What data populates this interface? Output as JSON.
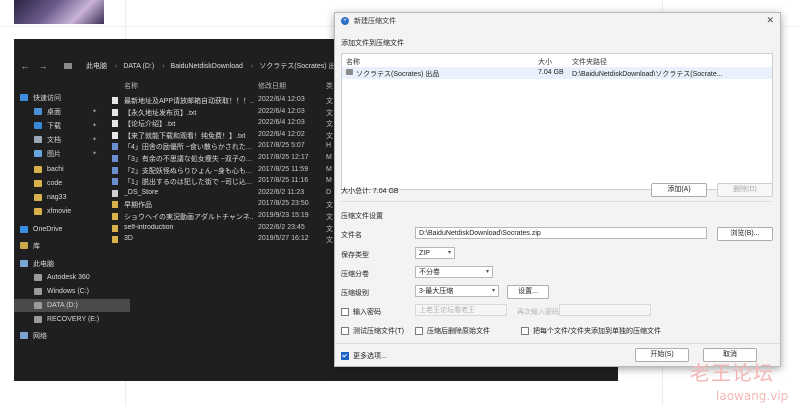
{
  "explorer": {
    "breadcrumb": [
      "此电脑",
      "DATA (D:)",
      "BaiduNetdiskDownload",
      "ソクラテス(Socrates) 出品"
    ],
    "columns": {
      "name": "名称",
      "date": "修改日期",
      "type": "类"
    },
    "sidebar": [
      {
        "label": "快速访问",
        "icon": "star-icon",
        "pinned": false,
        "level": 0
      },
      {
        "label": "桌面",
        "icon": "desktop-icon",
        "pinned": true,
        "level": 1
      },
      {
        "label": "下载",
        "icon": "download-icon",
        "pinned": true,
        "level": 1
      },
      {
        "label": "文档",
        "icon": "document-icon",
        "pinned": true,
        "level": 1
      },
      {
        "label": "图片",
        "icon": "picture-icon",
        "pinned": true,
        "level": 1
      },
      {
        "label": "bachi",
        "icon": "folder-icon",
        "pinned": false,
        "level": 1
      },
      {
        "label": "code",
        "icon": "folder-icon",
        "pinned": false,
        "level": 1
      },
      {
        "label": "nag33",
        "icon": "folder-icon",
        "pinned": false,
        "level": 1
      },
      {
        "label": "xfmovie",
        "icon": "folder-icon",
        "pinned": false,
        "level": 1
      },
      {
        "label": "OneDrive",
        "icon": "cloud-icon",
        "pinned": false,
        "level": 0
      },
      {
        "label": "库",
        "icon": "library-icon",
        "pinned": false,
        "level": 0
      },
      {
        "label": "此电脑",
        "icon": "computer-icon",
        "pinned": false,
        "level": 0
      },
      {
        "label": "Autodesk 360",
        "icon": "cloud-drive-icon",
        "pinned": false,
        "level": 1
      },
      {
        "label": "Windows (C:)",
        "icon": "drive-icon",
        "pinned": false,
        "level": 1
      },
      {
        "label": "DATA (D:)",
        "icon": "drive-icon",
        "pinned": false,
        "level": 1,
        "selected": true
      },
      {
        "label": "RECOVERY (E:)",
        "icon": "drive-icon",
        "pinned": false,
        "level": 1
      },
      {
        "label": "网络",
        "icon": "network-icon",
        "pinned": false,
        "level": 0
      }
    ],
    "files": [
      {
        "name": "最新地址及APP请放邮箱自动获取！！！...",
        "date": "2022/6/4 12:03",
        "type": "文",
        "icon": "text-file-icon"
      },
      {
        "name": "【永久地址发布页】.txt",
        "date": "2022/6/4 12:03",
        "type": "文",
        "icon": "text-file-icon"
      },
      {
        "name": "【论坛介绍】.txt",
        "date": "2022/6/4 12:03",
        "type": "文",
        "icon": "text-file-icon"
      },
      {
        "name": "【来了就能下载和观看！纯免费！】.txt",
        "date": "2022/6/4 12:02",
        "type": "文",
        "icon": "text-file-icon"
      },
      {
        "name": "「4」田舎の励優所 ~食い散らかされた...",
        "date": "2017/8/25 5:07",
        "type": "H",
        "icon": "media-file-icon"
      },
      {
        "name": "「3」有余の不思議な処女痩失 ~双子の...",
        "date": "2017/8/25 12:17",
        "type": "M",
        "icon": "media-file-icon"
      },
      {
        "name": "「2」支配妖怪ぬらりひょん ~身も心も...",
        "date": "2017/8/25 11:59",
        "type": "M",
        "icon": "media-file-icon"
      },
      {
        "name": "「1」脱出するのは犯した街で ~司じ込...",
        "date": "2017/8/25 11:16",
        "type": "M",
        "icon": "media-file-icon"
      },
      {
        "name": "_DS_Store",
        "date": "2022/6/2 11:23",
        "type": "D",
        "icon": "file-icon"
      },
      {
        "name": "早期作品",
        "date": "2017/8/25 23:50",
        "type": "文",
        "icon": "folder-icon"
      },
      {
        "name": "ショウヘイの実況動画アダルトチャンネ...",
        "date": "2019/9/23 15:19",
        "type": "文",
        "icon": "folder-icon"
      },
      {
        "name": "self-introduction",
        "date": "2022/6/2 23:45",
        "type": "文",
        "icon": "folder-icon"
      },
      {
        "name": "3D",
        "date": "2019/5/27 16:12",
        "type": "文",
        "icon": "folder-icon"
      }
    ]
  },
  "dialog": {
    "title": "新建压缩文件",
    "add_section": "添加文件到压缩文件",
    "headers": {
      "name": "名称",
      "size": "大小",
      "path": "文件夹路径"
    },
    "rows": [
      {
        "name": "ソクラテス(Socrates) 出品",
        "size": "7.04 GB",
        "path": "D:\\BaiduNetdiskDownload\\ソクラテス(Socrate..."
      }
    ],
    "total_size": "大小总计: 7.04 GB",
    "add_button": "添加(A)",
    "delete_button": "删除(D)",
    "settings_section": "压缩文件设置",
    "filename_label": "文件名",
    "filename_value": "D:\\BaiduNetdiskDownload\\Socrates.zip",
    "browse_button": "浏览(B)...",
    "format_label": "保存类型",
    "format_value": "ZIP",
    "split_label": "压缩分卷",
    "split_value": "不分卷",
    "level_label": "压缩级别",
    "level_value": "3-最大压缩",
    "settings_button": "设置...",
    "password_label": "输入密码",
    "password_placeholder": "上老王论坛看老王",
    "password_confirm_label": "再次输入密码",
    "opt_test": "测试压缩文件(T)",
    "opt_delete": "压缩后删除原始文件",
    "opt_separate": "把每个文件/文件夹添加到单独的压缩文件",
    "more_options": "更多选项...",
    "start_button": "开始(S)",
    "cancel_button": "取消"
  },
  "watermark": {
    "line1": "老王论坛",
    "line2": "laowang.vip"
  }
}
